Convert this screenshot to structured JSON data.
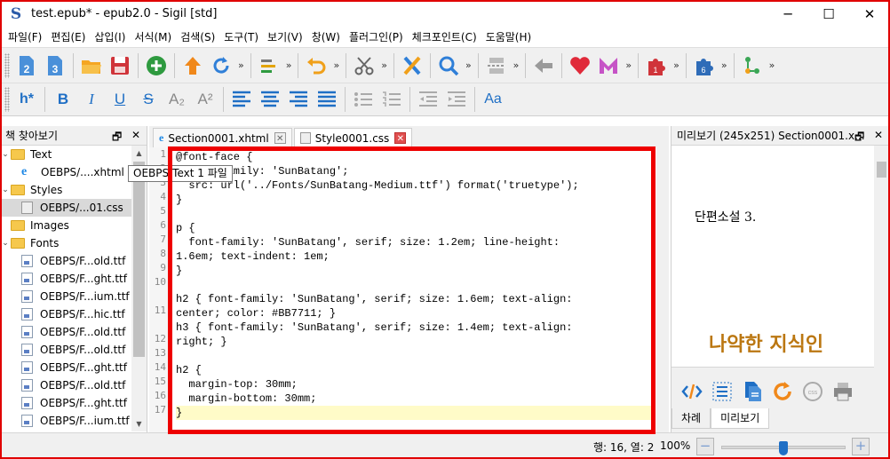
{
  "window": {
    "title": "test.epub* - epub2.0 - Sigil [std]",
    "minimize": "─",
    "maximize": "☐",
    "close": "✕"
  },
  "menu": [
    "파일(F)",
    "편집(E)",
    "삽입(I)",
    "서식(M)",
    "검색(S)",
    "도구(T)",
    "보기(V)",
    "창(W)",
    "플러그인(P)",
    "체크포인트(C)",
    "도움말(H)"
  ],
  "toolbar2": {
    "heading": "h*",
    "bold": "B",
    "italic": "I",
    "underline": "U",
    "strike": "S",
    "subscript": "A₂",
    "superscript": "A²",
    "case": "Aa"
  },
  "book_browser": {
    "title": "책 찾아보기",
    "float": "🗗",
    "close": "✕",
    "tooltip": "OEBPS/Text 1 파일",
    "items": [
      {
        "kind": "folder",
        "label": "Text"
      },
      {
        "kind": "xhtml",
        "label": "OEBPS/....xhtml"
      },
      {
        "kind": "folder",
        "label": "Styles"
      },
      {
        "kind": "css",
        "label": "OEBPS/...01.css"
      },
      {
        "kind": "folder",
        "label": "Images"
      },
      {
        "kind": "folder",
        "label": "Fonts"
      },
      {
        "kind": "font",
        "label": "OEBPS/F...old.ttf"
      },
      {
        "kind": "font",
        "label": "OEBPS/F...ght.ttf"
      },
      {
        "kind": "font",
        "label": "OEBPS/F...ium.ttf"
      },
      {
        "kind": "font",
        "label": "OEBPS/F...hic.ttf"
      },
      {
        "kind": "font",
        "label": "OEBPS/F...old.ttf"
      },
      {
        "kind": "font",
        "label": "OEBPS/F...old.ttf"
      },
      {
        "kind": "font",
        "label": "OEBPS/F...ght.ttf"
      },
      {
        "kind": "font",
        "label": "OEBPS/F...old.ttf"
      },
      {
        "kind": "font",
        "label": "OEBPS/F...ght.ttf"
      },
      {
        "kind": "font",
        "label": "OEBPS/F...ium.ttf"
      }
    ]
  },
  "tabs": [
    {
      "label": "Section0001.xhtml",
      "close": "✕"
    },
    {
      "label": "Style0001.css",
      "close": "✕"
    }
  ],
  "editor": {
    "line_numbers": [
      "1",
      "2",
      "3",
      "4",
      "5",
      "6",
      "7",
      "8",
      "9",
      "10",
      "",
      "11",
      "",
      "12",
      "13",
      "14",
      "15",
      "16",
      "17"
    ],
    "lines": [
      "@font-face {",
      "  font-family: 'SunBatang';",
      "  src: url('../Fonts/SunBatang-Medium.ttf') format('truetype');",
      "}",
      "",
      "p {",
      "  font-family: 'SunBatang', serif; size: 1.2em; line-height:",
      "1.6em; text-indent: 1em;",
      "}",
      "",
      "h2 { font-family: 'SunBatang', serif; size: 1.6em; text-align:",
      "center; color: #BB7711; }",
      "h3 { font-family: 'SunBatang', serif; size: 1.4em; text-align:",
      "right; }",
      "",
      "h2 {",
      "  margin-top: 30mm;",
      "  margin-bottom: 30mm;",
      "}"
    ]
  },
  "preview": {
    "title": "미리보기 (245x251) Section0001.x...",
    "float": "🗗",
    "close": "✕",
    "paragraph": "단편소설 3.",
    "heading": "나약한 지식인",
    "heading_color": "#BB7711",
    "tabs": [
      "차례",
      "미리보기"
    ]
  },
  "status": {
    "position": "행: 16, 열: 2",
    "zoom": "100%",
    "zoom_out": "−",
    "zoom_in": "+"
  },
  "colors": {
    "accent": "#1f6fc5",
    "highlight_red": "#ee0000"
  }
}
